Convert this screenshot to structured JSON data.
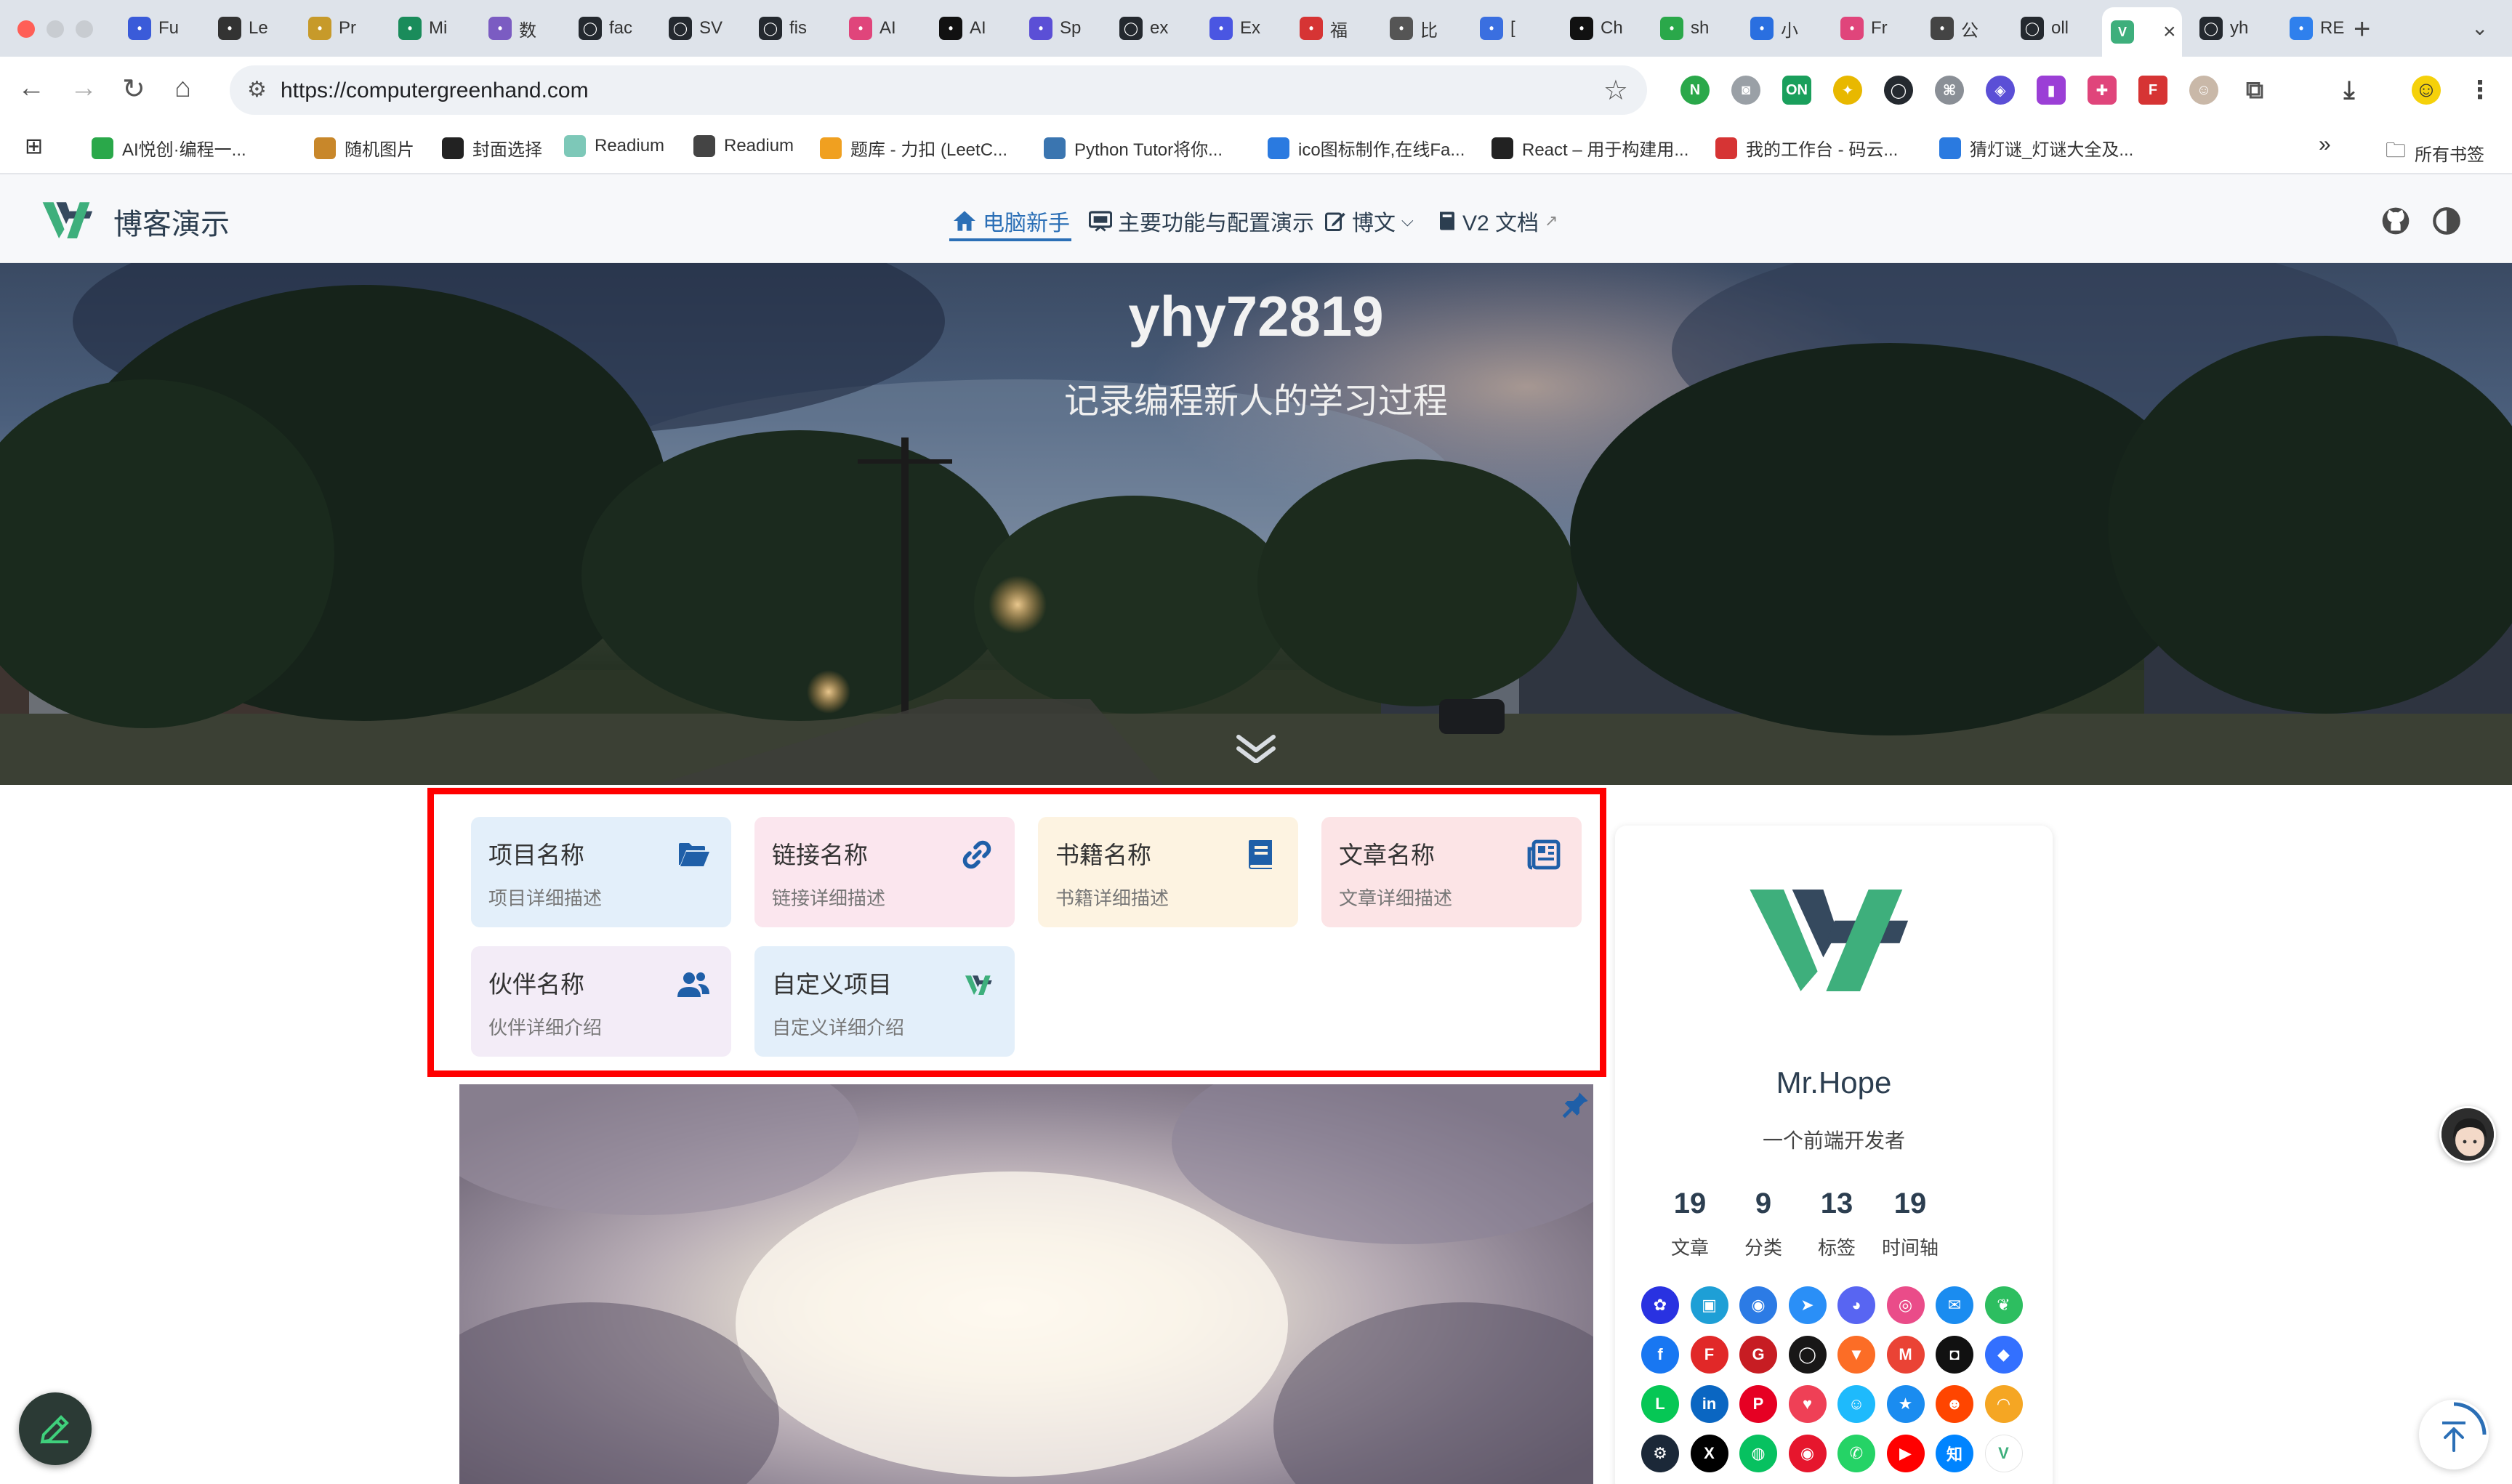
{
  "browser": {
    "tabs": [
      {
        "label": "Fu",
        "icon": "tab-icon-1",
        "color": "#3a5bd9"
      },
      {
        "label": "Le",
        "icon": "tab-icon-2",
        "color": "#333333"
      },
      {
        "label": "Pr",
        "icon": "tab-icon-3",
        "color": "#c79a2a"
      },
      {
        "label": "Mi",
        "icon": "tab-icon-4",
        "color": "#1a8c5b"
      },
      {
        "label": "数",
        "icon": "tab-icon-5",
        "color": "#7b5cc2"
      },
      {
        "label": "fac",
        "icon": "github-icon",
        "color": "#24292f"
      },
      {
        "label": "SV",
        "icon": "github-icon",
        "color": "#24292f"
      },
      {
        "label": "fis",
        "icon": "github-icon",
        "color": "#24292f"
      },
      {
        "label": "AI",
        "icon": "tab-icon-9",
        "color": "#e0457b"
      },
      {
        "label": "AI",
        "icon": "tab-icon-10",
        "color": "#111111"
      },
      {
        "label": "Sp",
        "icon": "tab-icon-11",
        "color": "#5b4fd6"
      },
      {
        "label": "ex",
        "icon": "github-icon",
        "color": "#24292f"
      },
      {
        "label": "Ex",
        "icon": "tab-icon-13",
        "color": "#4a56e2"
      },
      {
        "label": "福",
        "icon": "tab-icon-14",
        "color": "#d63434"
      },
      {
        "label": "比",
        "icon": "tab-icon-15",
        "color": "#555555"
      },
      {
        "label": "[",
        "icon": "tab-icon-16",
        "color": "#3a6fe0"
      },
      {
        "label": "Ch",
        "icon": "tab-icon-17",
        "color": "#111111"
      },
      {
        "label": "sh",
        "icon": "tab-icon-18",
        "color": "#2aa84a"
      },
      {
        "label": "小",
        "icon": "tab-icon-19",
        "color": "#2a6fe0"
      },
      {
        "label": "Fr",
        "icon": "tab-icon-20",
        "color": "#e0457b"
      },
      {
        "label": "公",
        "icon": "tab-icon-21",
        "color": "#444444"
      },
      {
        "label": "oll",
        "icon": "github-icon",
        "color": "#24292f"
      },
      {
        "label": "",
        "icon": "vuepress-icon",
        "color": "#3eaf7c",
        "active": true
      },
      {
        "label": "yh",
        "icon": "github-icon",
        "color": "#24292f"
      },
      {
        "label": "RE",
        "icon": "vscode-icon",
        "color": "#2f80ed"
      }
    ],
    "url": "https://computergreenhand.com",
    "bookmarks": [
      {
        "label": "AI悦创·编程一...",
        "color": "#2aa84a"
      },
      {
        "label": "随机图片",
        "color": "#c8872a"
      },
      {
        "label": "封面选择",
        "color": "#222222"
      },
      {
        "label": "Readium",
        "color": "#7dc8b8"
      },
      {
        "label": "Readium",
        "color": "#444444"
      },
      {
        "label": "题库 - 力扣 (LeetC...",
        "color": "#f0a020"
      },
      {
        "label": "Python Tutor将你...",
        "color": "#3a75b0"
      },
      {
        "label": "ico图标制作,在线Fa...",
        "color": "#2a7ae0"
      },
      {
        "label": "React – 用于构建用...",
        "color": "#222222"
      },
      {
        "label": "我的工作台 - 码云...",
        "color": "#d63434"
      },
      {
        "label": "猜灯谜_灯谜大全及...",
        "color": "#2a7ae0"
      }
    ],
    "all_bookmarks": "所有书签"
  },
  "site": {
    "brand": "博客演示",
    "nav": [
      {
        "label": "电脑新手",
        "icon": "home-icon",
        "active": true
      },
      {
        "label": "主要功能与配置演示",
        "icon": "slides-icon"
      },
      {
        "label": "博文",
        "icon": "edit-icon",
        "dropdown": true
      },
      {
        "label": "V2 文档",
        "icon": "book-icon",
        "external": "↗"
      }
    ]
  },
  "hero": {
    "title": "yhy72819",
    "subtitle": "记录编程新人的学习过程"
  },
  "projects": [
    {
      "name": "项目名称",
      "desc": "项目详细描述",
      "icon": "folder-open-icon",
      "bg": "#e3effa"
    },
    {
      "name": "链接名称",
      "desc": "链接详细描述",
      "icon": "link-icon",
      "bg": "#fbe6ee"
    },
    {
      "name": "书籍名称",
      "desc": "书籍详细描述",
      "icon": "book-icon",
      "bg": "#fdf3e1"
    },
    {
      "name": "文章名称",
      "desc": "文章详细描述",
      "icon": "newspaper-icon",
      "bg": "#fce4e6"
    },
    {
      "name": "伙伴名称",
      "desc": "伙伴详细介绍",
      "icon": "users-icon",
      "bg": "#f3ecf7"
    },
    {
      "name": "自定义项目",
      "desc": "自定义详细介绍",
      "icon": "vuepress-logo-icon",
      "bg": "#e3effa"
    }
  ],
  "blogger": {
    "name": "Mr.Hope",
    "description": "一个前端开发者",
    "stats": [
      {
        "value": "19",
        "label": "文章"
      },
      {
        "value": "9",
        "label": "分类"
      },
      {
        "value": "13",
        "label": "标签"
      },
      {
        "value": "19",
        "label": "时间轴"
      }
    ],
    "socials": [
      {
        "name": "baidu-icon",
        "color": "#2932e1",
        "glyph": "✿"
      },
      {
        "name": "bilibili-icon",
        "color": "#1e9fd6",
        "glyph": "▣"
      },
      {
        "name": "bitbucket-icon",
        "color": "#2c7be5",
        "glyph": "◉"
      },
      {
        "name": "dingding-icon",
        "color": "#2a8ff7",
        "glyph": "➤"
      },
      {
        "name": "discord-icon",
        "color": "#5865f2",
        "glyph": "◕"
      },
      {
        "name": "dribbble-icon",
        "color": "#ea4c89",
        "glyph": "◎"
      },
      {
        "name": "email-icon",
        "color": "#1a8cf0",
        "glyph": "✉"
      },
      {
        "name": "evernote-icon",
        "color": "#2dbe60",
        "glyph": "❦"
      },
      {
        "name": "facebook-icon",
        "color": "#1877f2",
        "glyph": "f"
      },
      {
        "name": "flipboard-icon",
        "color": "#e12828",
        "glyph": "F"
      },
      {
        "name": "gitee-icon",
        "color": "#c71d23",
        "glyph": "G"
      },
      {
        "name": "github-icon",
        "color": "#181717",
        "glyph": "◯"
      },
      {
        "name": "gitlab-icon",
        "color": "#fc6d26",
        "glyph": "▼"
      },
      {
        "name": "gmail-icon",
        "color": "#ea4335",
        "glyph": "M"
      },
      {
        "name": "instagram-icon",
        "color": "#111111",
        "glyph": "◘"
      },
      {
        "name": "lark-icon",
        "color": "#3370ff",
        "glyph": "◆"
      },
      {
        "name": "line-icon",
        "color": "#06c755",
        "glyph": "L"
      },
      {
        "name": "linkedin-icon",
        "color": "#0a66c2",
        "glyph": "in"
      },
      {
        "name": "pinterest-icon",
        "color": "#e60023",
        "glyph": "P"
      },
      {
        "name": "pocket-icon",
        "color": "#ef4056",
        "glyph": "♥"
      },
      {
        "name": "qq-icon",
        "color": "#1ebafc",
        "glyph": "☺"
      },
      {
        "name": "qzone-icon",
        "color": "#1a8cf0",
        "glyph": "★"
      },
      {
        "name": "reddit-icon",
        "color": "#ff4500",
        "glyph": "☻"
      },
      {
        "name": "rss-icon",
        "color": "#f5a623",
        "glyph": "◠"
      },
      {
        "name": "steam-icon",
        "color": "#1b2838",
        "glyph": "⚙"
      },
      {
        "name": "x-twitter-icon",
        "color": "#000000",
        "glyph": "X"
      },
      {
        "name": "wechat-icon",
        "color": "#07c160",
        "glyph": "◍"
      },
      {
        "name": "weibo-icon",
        "color": "#e6162d",
        "glyph": "◉"
      },
      {
        "name": "whatsapp-icon",
        "color": "#25d366",
        "glyph": "✆"
      },
      {
        "name": "youtube-icon",
        "color": "#ff0000",
        "glyph": "▶"
      },
      {
        "name": "zhihu-icon",
        "color": "#0084ff",
        "glyph": "知"
      },
      {
        "name": "vuepress-icon",
        "color": "#ffffff",
        "glyph": "V"
      }
    ]
  },
  "colors": {
    "accent": "#2b6fb6",
    "brand_green": "#3eaf7c",
    "brand_dark": "#35495e",
    "highlight_border": "#ff0000"
  }
}
